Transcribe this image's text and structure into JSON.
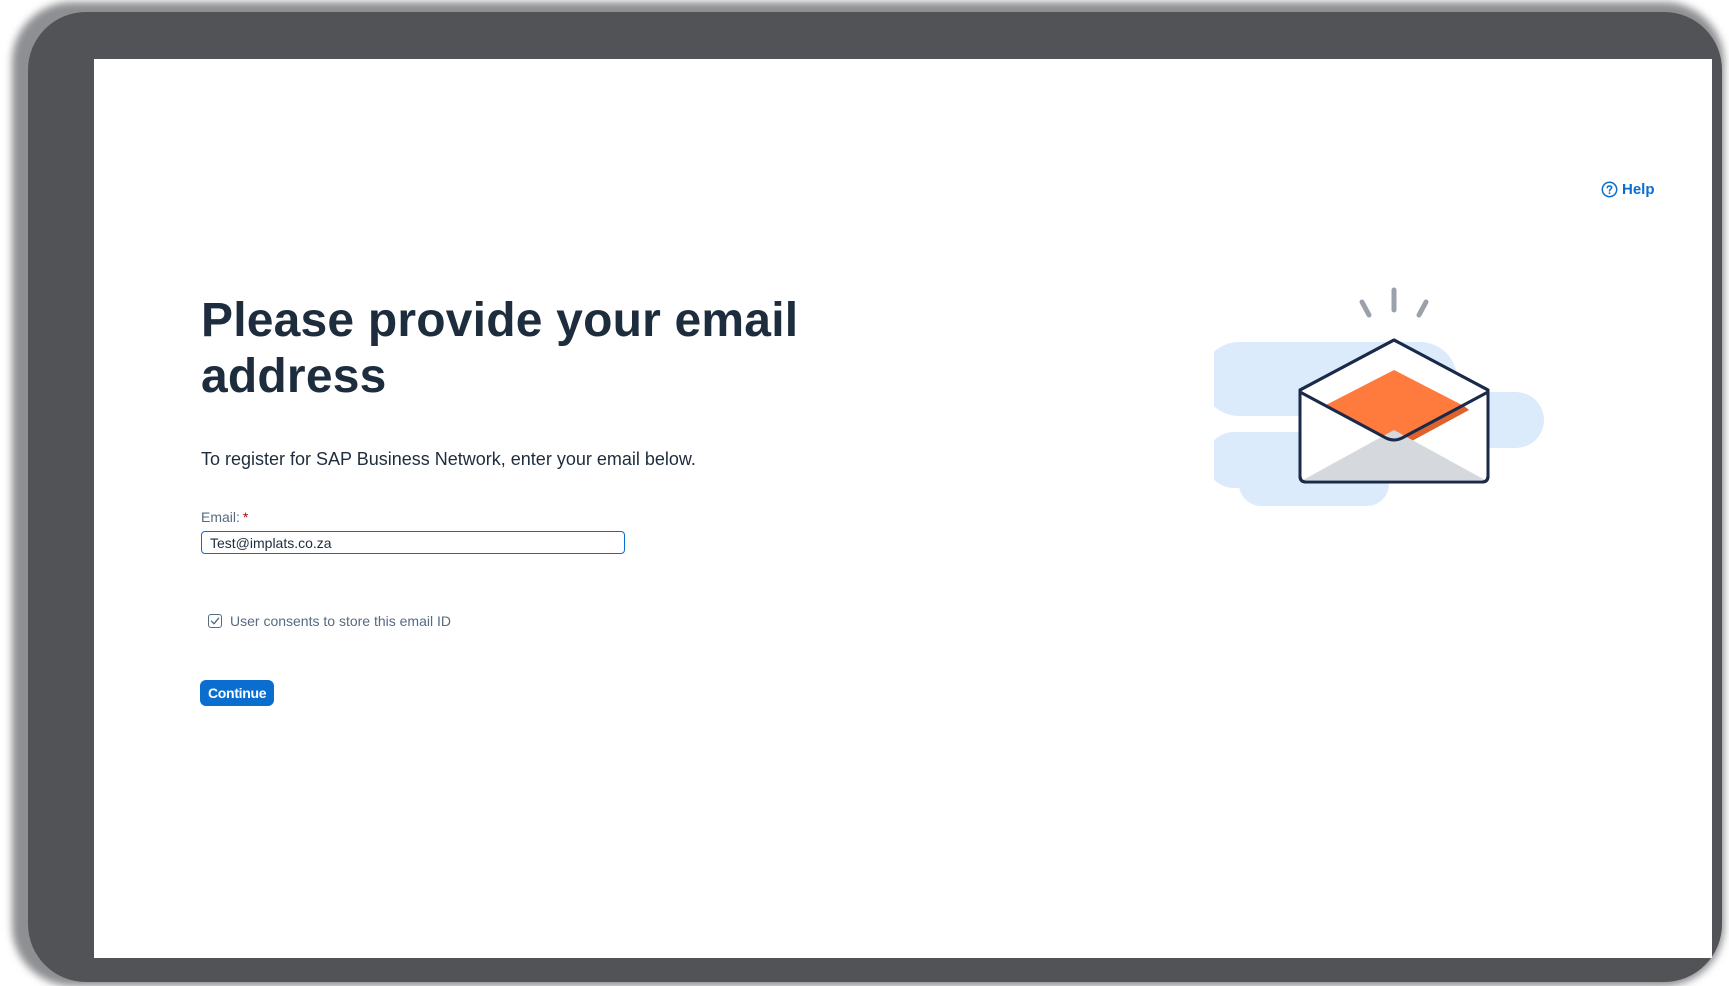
{
  "help": {
    "label": "Help",
    "icon": "question-circle-icon",
    "color": "#0a6ed1"
  },
  "page": {
    "title": "Please provide your email address",
    "subtitle": "To register for SAP Business Network, enter your email below."
  },
  "form": {
    "email_label": "Email:",
    "required_marker": "*",
    "email_value": "Test@implats.co.za",
    "consent_label": "User consents to store this email ID",
    "consent_checked": true,
    "continue_label": "Continue"
  },
  "illustration": {
    "icon": "open-envelope-illustration",
    "accent": "#ff7a3d",
    "cloud": "#dcebfb",
    "outline": "#1a2a4a"
  },
  "colors": {
    "primary": "#0a6ed1",
    "text": "#1d2d3e",
    "frame": "#515357"
  }
}
